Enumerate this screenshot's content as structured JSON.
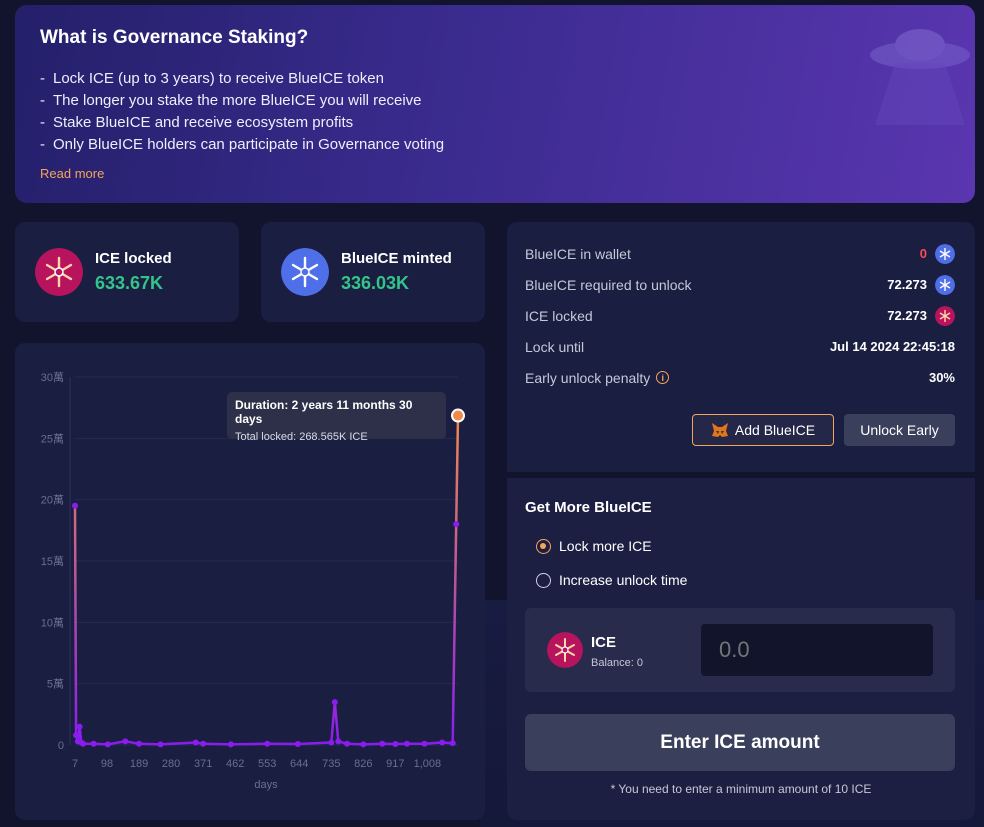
{
  "banner": {
    "title": "What is Governance Staking?",
    "bullets": [
      "Lock ICE (up to 3 years) to receive BlueICE token",
      "The longer you stake the more BlueICE you will receive",
      "Stake BlueICE and receive ecosystem profits",
      "Only BlueICE holders can participate in Governance voting"
    ],
    "bullet_prefix": "-",
    "read_more": "Read more"
  },
  "stats": {
    "ice_locked": {
      "label": "ICE locked",
      "value": "633.67K"
    },
    "blueice_minted": {
      "label": "BlueICE minted",
      "value": "336.03K"
    }
  },
  "chart_data": {
    "type": "line",
    "xlabel": "days",
    "x_ticks": [
      "7",
      "98",
      "189",
      "280",
      "371",
      "462",
      "553",
      "644",
      "735",
      "826",
      "917",
      "1,008"
    ],
    "y_ticks": [
      "0",
      "5萬",
      "10萬",
      "15萬",
      "20萬",
      "25萬",
      "30萬"
    ],
    "ylim": [
      0,
      300000
    ],
    "xlim": [
      7,
      1095
    ],
    "series": [
      {
        "values": [
          [
            7,
            195000
          ],
          [
            10,
            8000
          ],
          [
            15,
            3000
          ],
          [
            20,
            15000
          ],
          [
            25,
            2000
          ],
          [
            30,
            1000
          ],
          [
            60,
            1000
          ],
          [
            100,
            500
          ],
          [
            150,
            3000
          ],
          [
            189,
            1000
          ],
          [
            250,
            500
          ],
          [
            350,
            2000
          ],
          [
            371,
            1000
          ],
          [
            450,
            500
          ],
          [
            553,
            1000
          ],
          [
            640,
            800
          ],
          [
            735,
            2000
          ],
          [
            745,
            35000
          ],
          [
            755,
            3000
          ],
          [
            780,
            1000
          ],
          [
            826,
            500
          ],
          [
            880,
            1000
          ],
          [
            917,
            800
          ],
          [
            950,
            1000
          ],
          [
            1000,
            1000
          ],
          [
            1050,
            2000
          ],
          [
            1080,
            1500
          ],
          [
            1090,
            180000
          ],
          [
            1095,
            268565
          ]
        ]
      }
    ],
    "tooltip": {
      "title": "Duration: 2 years 11 months 30 days",
      "value": "Total locked: 268.565K ICE"
    },
    "colors": {
      "line_top": "#f08a4b",
      "line_bottom": "#8a1cf0",
      "marker": "#f08a4b"
    }
  },
  "wallet": {
    "rows": [
      {
        "label": "BlueICE in wallet",
        "value": "0"
      },
      {
        "label": "BlueICE required to unlock",
        "value": "72.273"
      },
      {
        "label": "ICE locked",
        "value": "72.273"
      },
      {
        "label": "Lock until",
        "value": "Jul 14 2024 22:45:18"
      },
      {
        "label": "Early unlock penalty",
        "value": "30%"
      }
    ],
    "add_button": "Add BlueICE",
    "unlock_button": "Unlock Early"
  },
  "get_more": {
    "title": "Get More BlueICE",
    "options": [
      "Lock more ICE",
      "Increase unlock time"
    ],
    "selected": "Lock more ICE",
    "token": "ICE",
    "balance": "Balance: 0",
    "input_placeholder": "0.0",
    "submit": "Enter ICE amount",
    "note": "* You need to enter a minimum amount of 10 ICE"
  },
  "colors": {
    "accent_orange": "#f4a55a",
    "value_green": "#33c48a",
    "danger_red": "#ff4a5e",
    "ice_coin": "#b8145e",
    "blueice_coin": "#4f6fe8"
  }
}
